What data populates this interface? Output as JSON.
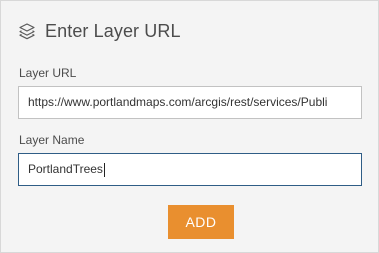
{
  "header": {
    "icon": "layers-icon",
    "title": "Enter Layer URL"
  },
  "form": {
    "layer_url_label": "Layer URL",
    "layer_url_value": "https://www.portlandmaps.com/arcgis/rest/services/Publi",
    "layer_name_label": "Layer Name",
    "layer_name_value": "PortlandTrees"
  },
  "actions": {
    "add_label": "ADD",
    "add_color": "#e98f2f"
  }
}
